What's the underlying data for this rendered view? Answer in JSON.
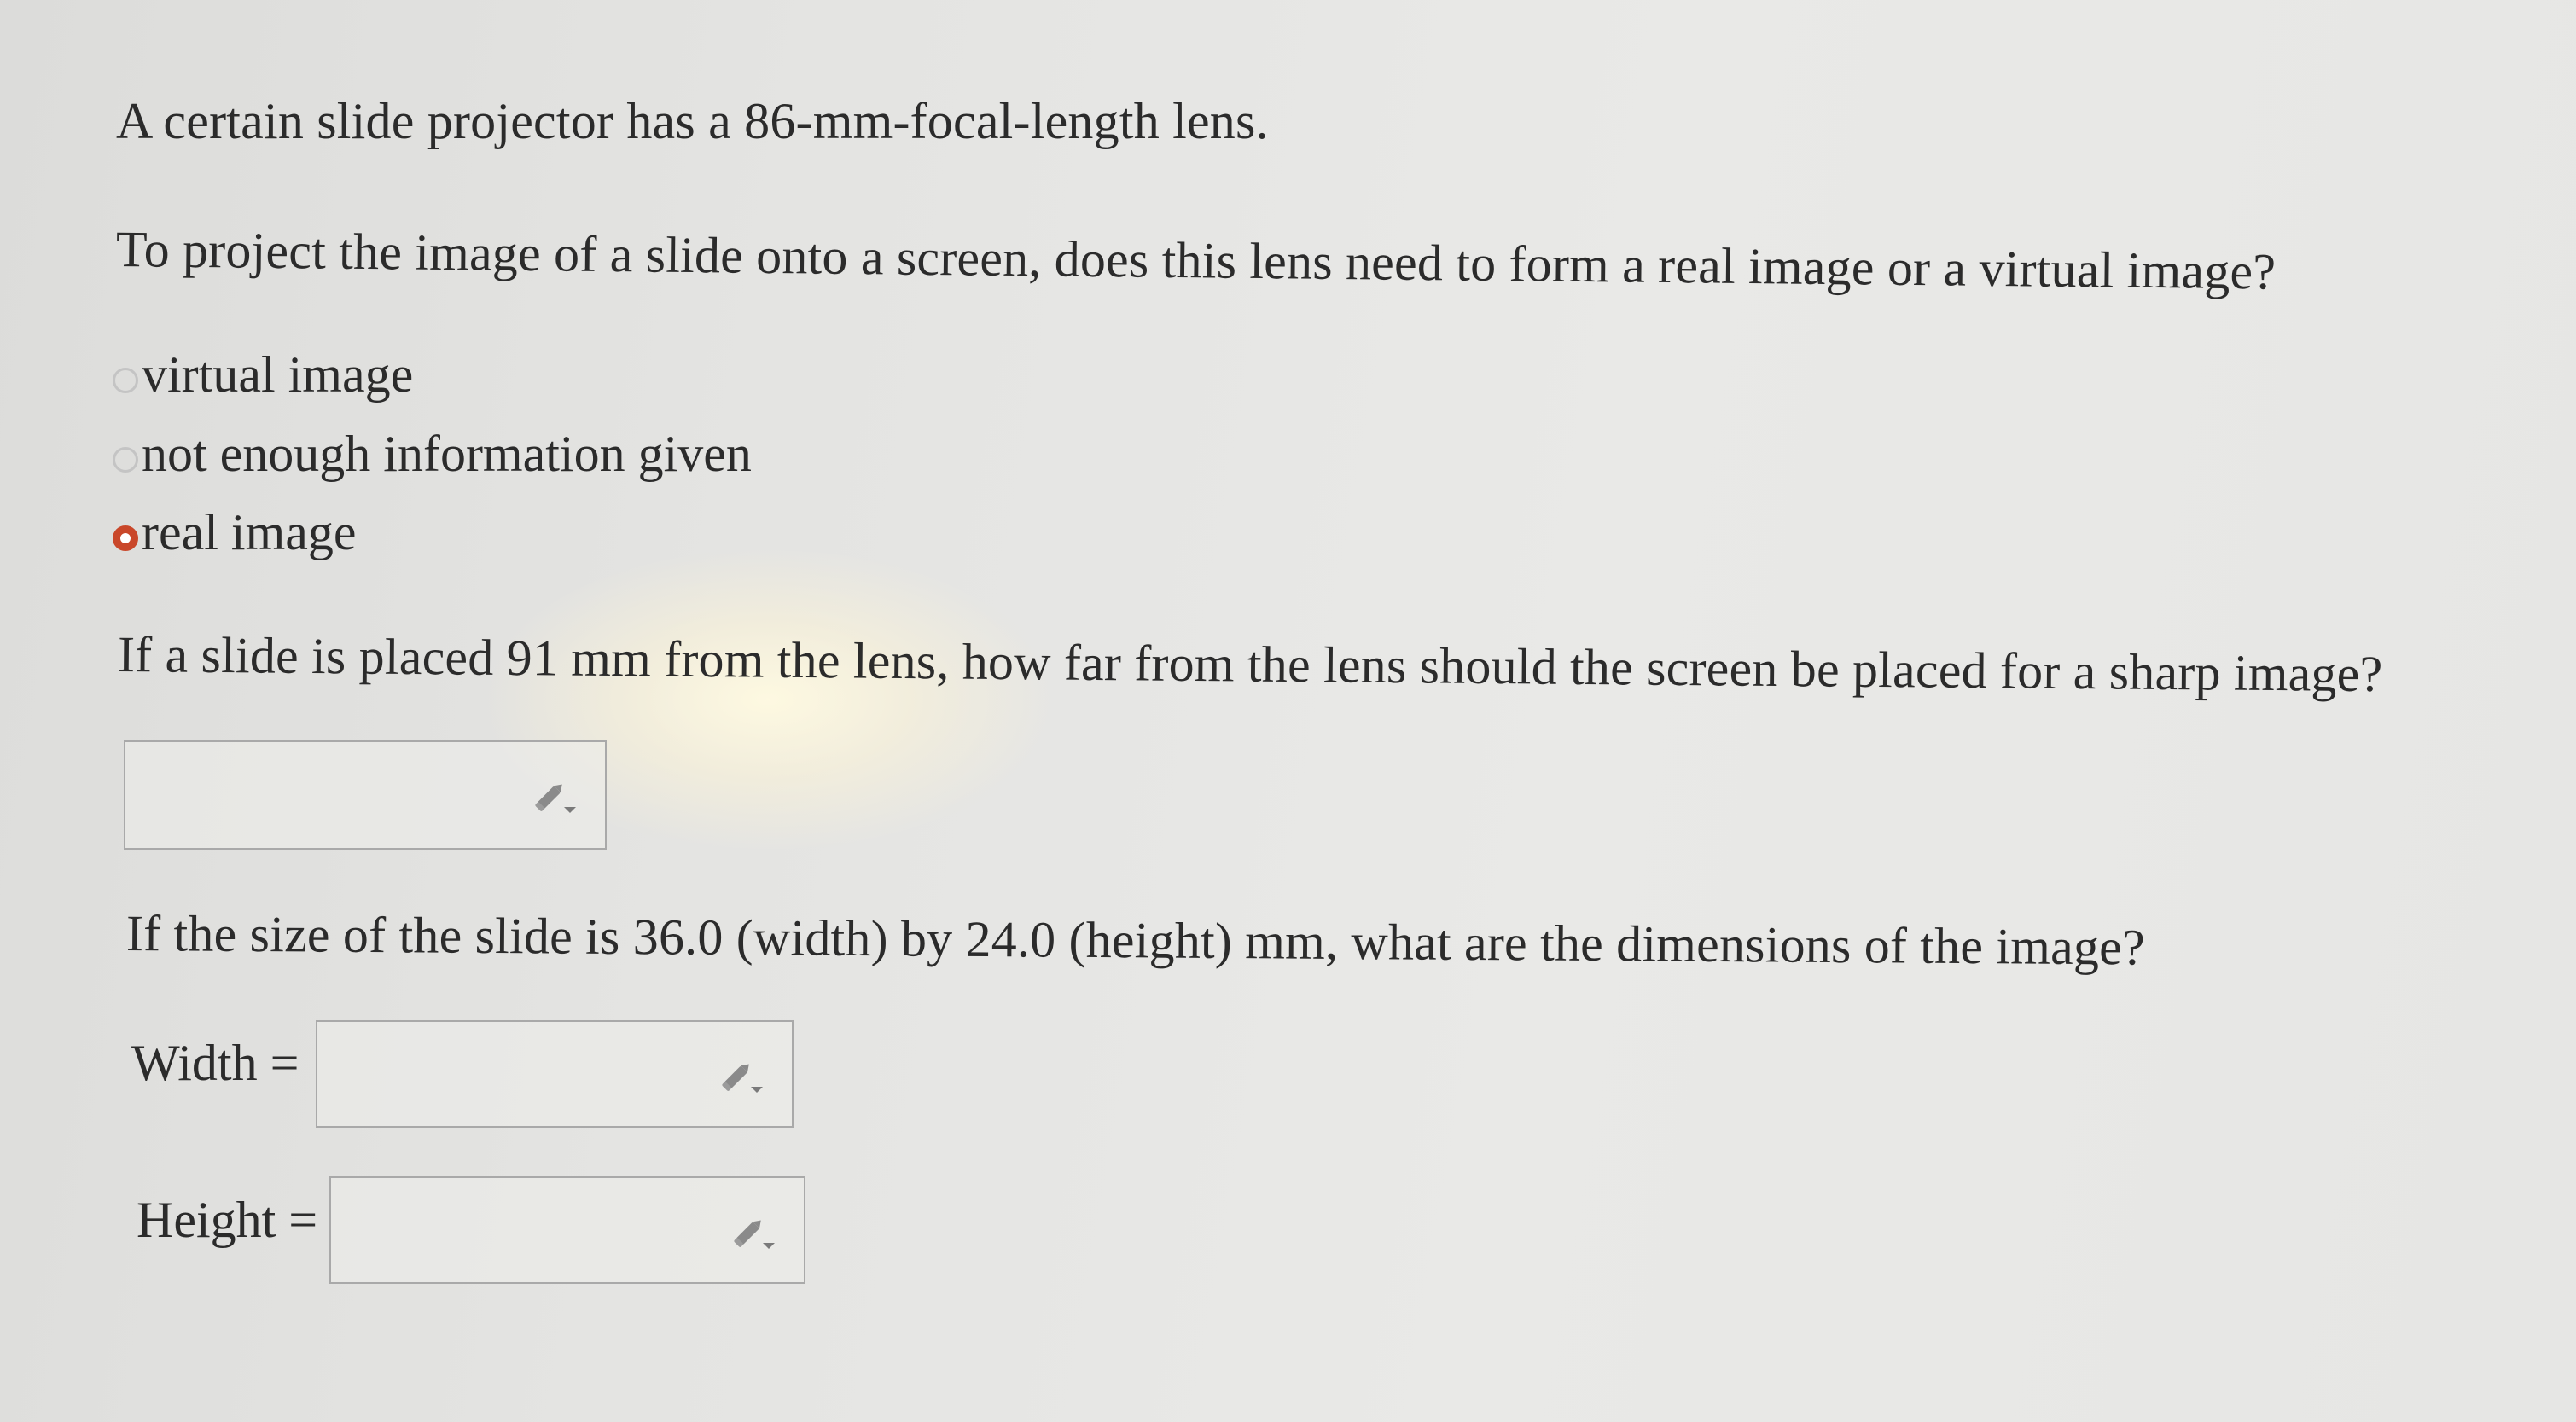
{
  "question": {
    "intro": "A certain slide projector has a 86-mm-focal-length lens.",
    "part1_prompt": "To project the image of a slide onto a screen, does this lens need to form a real image or a virtual image?",
    "options": [
      {
        "label": "virtual image",
        "selected": false
      },
      {
        "label": "not enough information given",
        "selected": false
      },
      {
        "label": "real image",
        "selected": true
      }
    ],
    "part2_prompt": "If a slide is placed 91 mm from the lens, how far from the lens should the screen be placed for a sharp image?",
    "part3_prompt": "If the size of the slide is 36.0 (width) by 24.0 (height) mm, what are the dimensions of the image?",
    "width_label": "Width =",
    "height_label": "Height ="
  },
  "inputs": {
    "distance_value": "",
    "width_value": "",
    "height_value": ""
  },
  "colors": {
    "selected_radio": "#c9472a",
    "text": "#2b2b2b",
    "box_border": "#a9a9a9"
  },
  "icons": {
    "edit": "pencil-edit-icon"
  }
}
